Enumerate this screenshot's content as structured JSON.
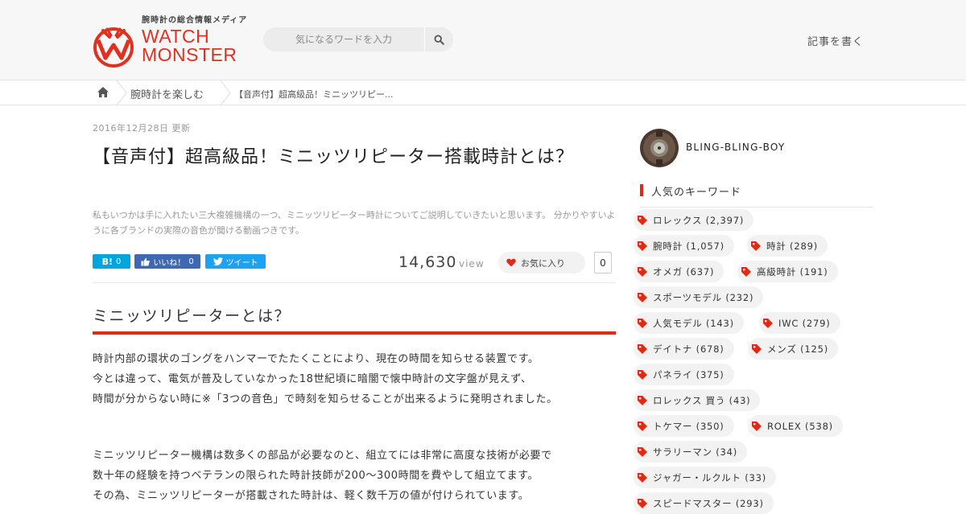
{
  "header": {
    "tagline": "腕時計の総合情報メディア",
    "brand_line1": "WATCH",
    "brand_line2": "MONSTER",
    "search_placeholder": "気になるワードを入力",
    "write_link": "記事を書く",
    "accent": "#e03020"
  },
  "breadcrumb": {
    "items": [
      "腕時計を楽しむ",
      "【音声付】超高級品！ミニッツリピー..."
    ]
  },
  "article": {
    "date": "2016年12月28日 更新",
    "title": "【音声付】超高級品！ミニッツリピーター搭載時計とは？",
    "lead": "私もいつかは手に入れたい三大複雑機構の一つ、ミニッツリピーター時計についてご説明していきたいと思います。 分かりやすいように各ブランドの実際の音色が聞ける動画つきです。",
    "share": {
      "hatena_label": "B!",
      "hatena_count": "0",
      "fb_label": "いいね！",
      "fb_count": "0",
      "tw_label": "ツイート"
    },
    "views": "14,630",
    "views_unit": "view",
    "fav_label": "お気に入り",
    "fav_count": "0",
    "section_heading": "ミニッツリピーターとは？",
    "paragraph1": [
      "時計内部の環状のゴングをハンマーでたたくことにより、現在の時間を知らせる装置です。",
      "今とは違って、電気が普及していなかった18世紀頃に暗闇で懐中時計の文字盤が見えず、",
      "時間が分からない時に※「3つの音色」で時刻を知らせることが出来るように発明されました。"
    ],
    "paragraph2": [
      "ミニッツリピーター機構は数多くの部品が必要なのと、組立てには非常に高度な技術が必要で",
      "数十年の経験を持つベテランの限られた時計技師が200～300時間を費やして組立てます。",
      "その為、ミニッツリピーターが搭載された時計は、軽く数千万の値が付けられています。"
    ]
  },
  "sidebar": {
    "username": "BLING-BLING-BOY",
    "keywords_heading": "人気のキーワード",
    "keywords": [
      "ロレックス (2,397)",
      "腕時計 (1,057)",
      "時計 (289)",
      "オメガ (637)",
      "高級時計 (191)",
      "スポーツモデル (232)",
      "人気モデル (143)",
      "IWC (279)",
      "デイトナ (678)",
      "メンズ (125)",
      "パネライ (375)",
      "ロレックス 買う (43)",
      "トケマー (350)",
      "ROLEX (538)",
      "サラリーマン (34)",
      "ジャガー・ルクルト (33)",
      "スピードマスター (293)"
    ],
    "tag_color": "#e02a14"
  }
}
